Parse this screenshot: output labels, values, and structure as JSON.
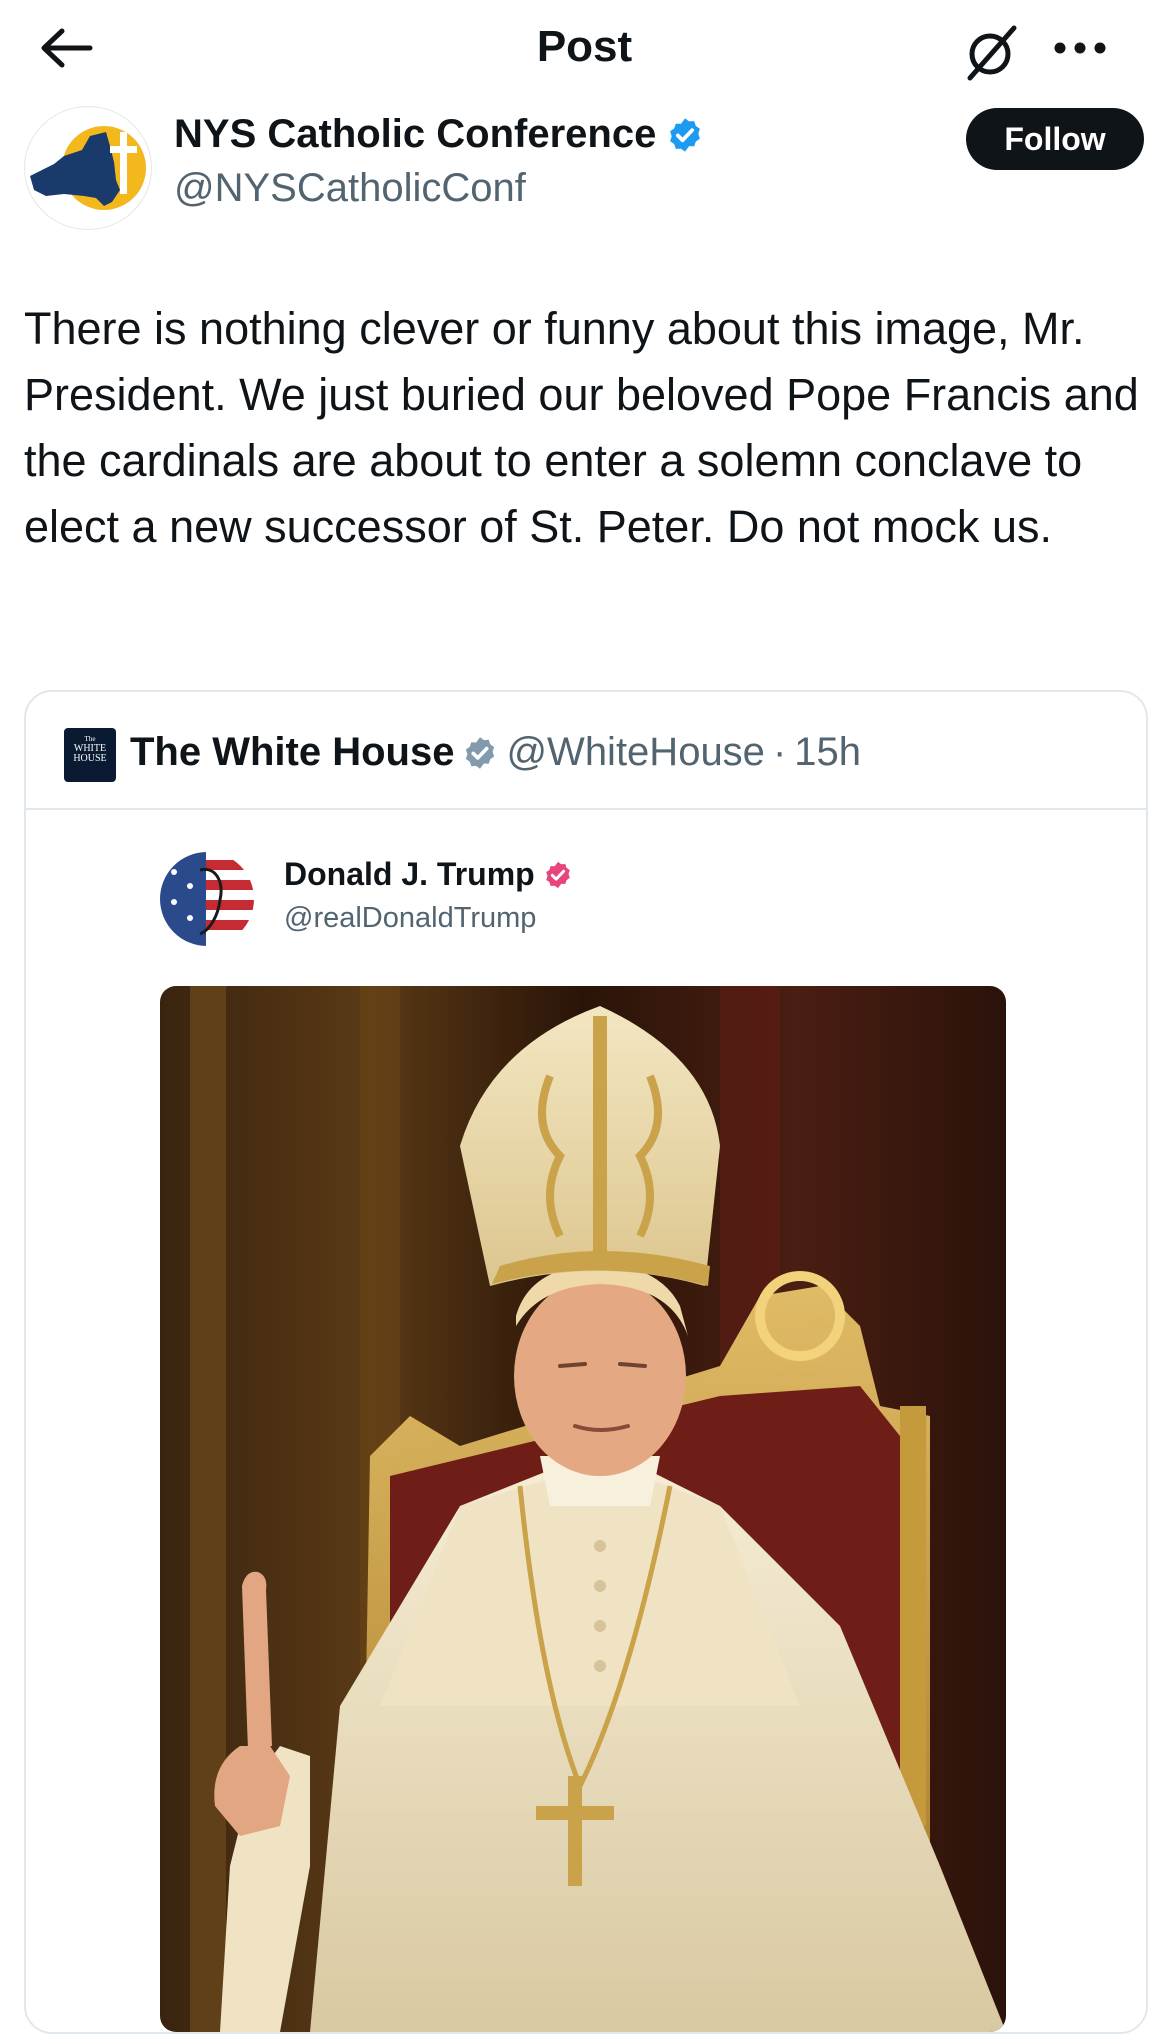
{
  "header": {
    "title": "Post",
    "back_icon": "arrow-left-icon",
    "grok_icon": "slashed-circle-icon",
    "more_icon": "ellipsis-icon"
  },
  "post": {
    "author_name": "NYS Catholic Conference",
    "author_handle": "@NYSCatholicConf",
    "follow_label": "Follow",
    "text": "There is nothing clever or funny about this image, Mr. President. We just buried our beloved Pope Francis and the cardinals are about to enter a solemn conclave to elect a new successor of St. Peter. Do not mock us."
  },
  "quoted": {
    "author_name": "The White House",
    "author_handle": "@WhiteHouse",
    "separator": "·",
    "time": "15h",
    "logo_text": [
      "The",
      "WHITE",
      "HOUSE"
    ],
    "inner": {
      "name": "Donald J. Trump",
      "handle": "@realDonaldTrump"
    }
  },
  "colors": {
    "verified_blue": "#1d9bf0",
    "gov_gray": "#829aab",
    "inner_badge_pink": "#e8457a",
    "follow_bg": "#0f1419",
    "secondary_text": "#536471"
  }
}
